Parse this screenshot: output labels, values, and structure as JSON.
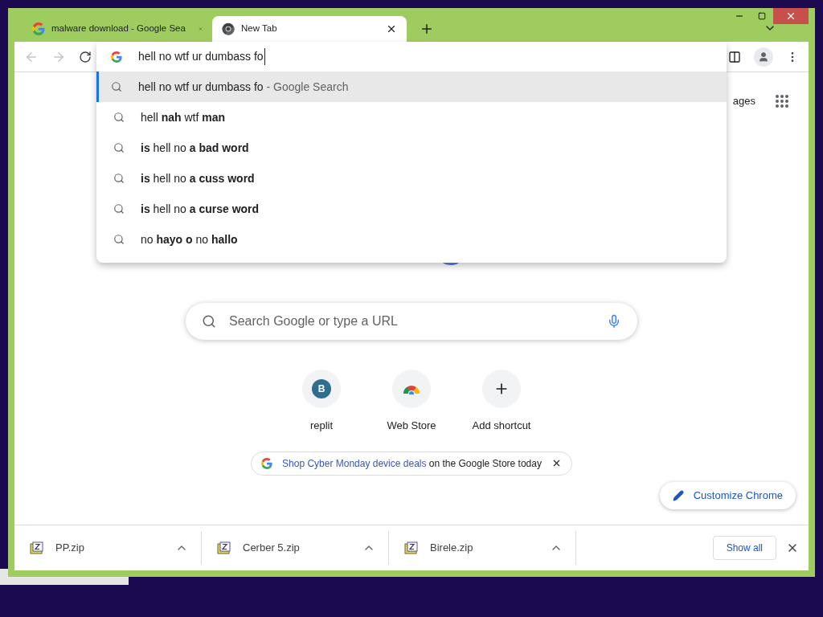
{
  "tabs": [
    {
      "kind": "google",
      "title": "malware download - Google Sea",
      "selected": false
    },
    {
      "kind": "chrome",
      "title": "New Tab",
      "selected": true
    }
  ],
  "omnibox": {
    "value": "hell no wtf ur dumbass fo"
  },
  "suggestions": [
    {
      "text": "hell no wtf ur dumbass fo",
      "suffix": "- Google Search",
      "selected": true
    },
    {
      "text": "hell **nah** wtf **man**",
      "selected": false
    },
    {
      "text": "**is** hell no **a bad word**",
      "selected": false
    },
    {
      "text": "**is** hell no **a cuss word**",
      "selected": false
    },
    {
      "text": "**is** hell no **a curse word**",
      "selected": false
    },
    {
      "text": "no **hayo o** no **hallo**",
      "selected": false
    }
  ],
  "header_link": "ages",
  "search": {
    "placeholder": "Search Google or type a URL"
  },
  "shortcuts": [
    {
      "kind": "letter",
      "letter": "B",
      "label": "replit"
    },
    {
      "kind": "webstore",
      "label": "Web Store"
    },
    {
      "kind": "add",
      "label": "Add shortcut"
    }
  ],
  "promo": {
    "link": "Shop Cyber Monday device deals",
    "text": "on the Google Store today"
  },
  "customize_button": "Customize Chrome",
  "downloads": [
    {
      "name": "PP.zip"
    },
    {
      "name": "Cerber 5.zip"
    },
    {
      "name": "Birele.zip"
    }
  ],
  "show_all": "Show all"
}
